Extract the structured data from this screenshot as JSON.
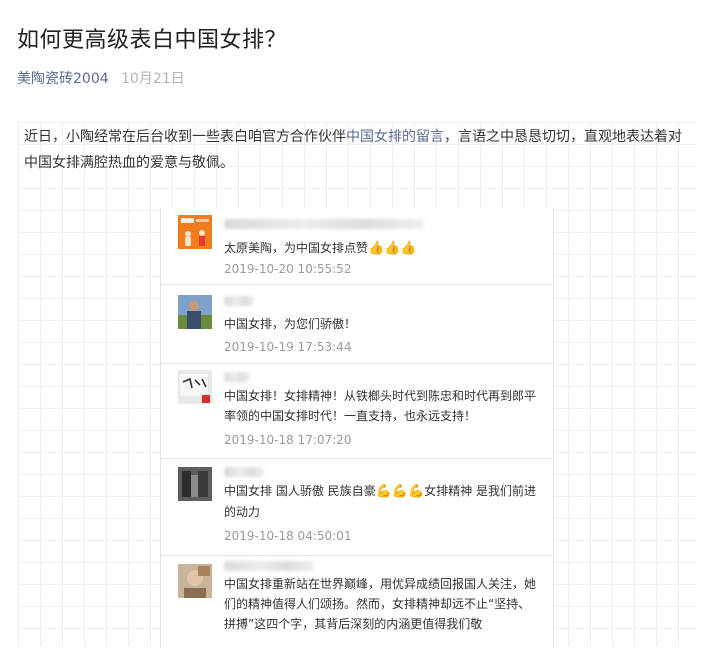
{
  "article": {
    "title": "如何更高级表白中国女排？",
    "author": "美陶瓷砖2004",
    "date": "10月21日",
    "intro_part1": "近日，小陶经常在后台收到一些表白咱官方合作伙伴",
    "intro_link": "中国女排的留言",
    "intro_part2": "，言语之中恳恳切切，直观地表达着对中国女排满腔热血的爱意与敬佩。"
  },
  "comments": [
    {
      "text": "太原美陶，为中国女排点赞",
      "emoji": "👍👍👍",
      "time": "2019-10-20 10:55:52"
    },
    {
      "text": "中国女排，为您们骄傲！",
      "emoji": "",
      "time": "2019-10-19 17:53:44"
    },
    {
      "text": "中国女排！女排精神！从铁榔头时代到陈忠和时代再到郎平率领的中国女排时代！一直支持，也永远支持！",
      "emoji": "",
      "time": "2019-10-18 17:07:20"
    },
    {
      "text_before": "中国女排 国人骄傲 民族自豪",
      "emoji": "💪💪💪",
      "text_after": "女排精神 是我们前进的动力",
      "time": "2019-10-18 04:50:01"
    },
    {
      "text": "中国女排重新站在世界巅峰，用优异成绩回报国人关注，她们的精神值得人们颂扬。然而，女排精神却远不止“坚持、拼搏”这四个字，其背后深刻的内涵更值得我们敬",
      "emoji": "",
      "time": ""
    }
  ]
}
